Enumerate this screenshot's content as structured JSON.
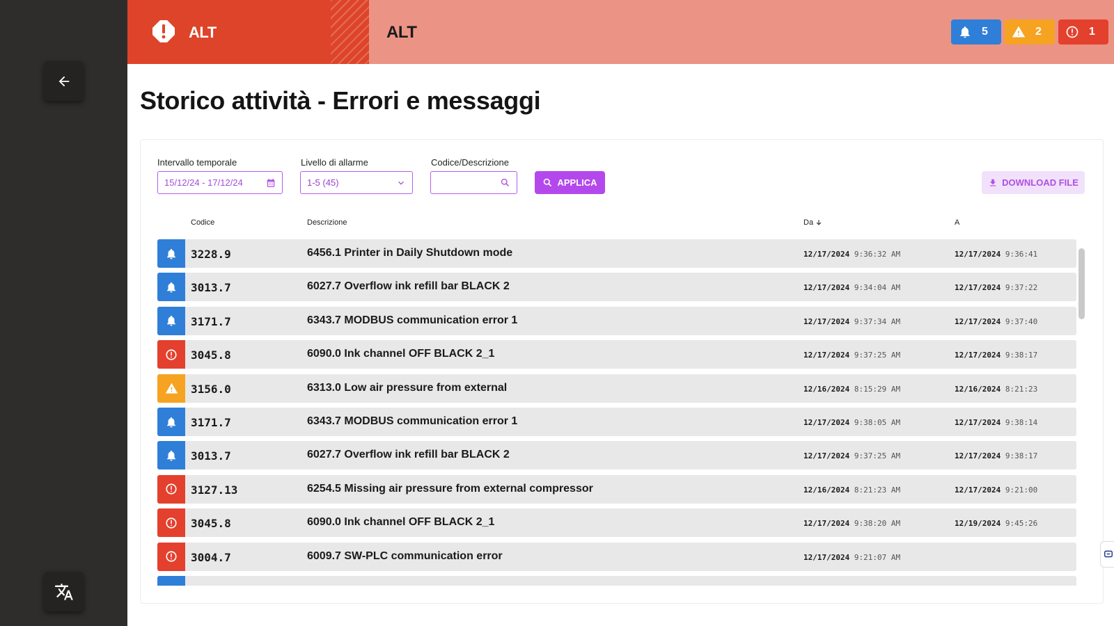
{
  "header": {
    "left_title": "ALT",
    "right_title": "ALT",
    "badges": [
      {
        "icon": "bell-icon",
        "count": "5",
        "color": "#2f7fd8"
      },
      {
        "icon": "warning-icon",
        "count": "2",
        "color": "#f6a321"
      },
      {
        "icon": "error-icon",
        "count": "1",
        "color": "#e4402e"
      }
    ]
  },
  "page": {
    "title": "Storico attività - Errori e messaggi"
  },
  "filters": {
    "interval_label": "Intervallo temporale",
    "interval_value": "15/12/24 - 17/12/24",
    "level_label": "Livello di allarme",
    "level_value": "1-5 (45)",
    "code_label": "Codice/Descrizione",
    "code_value": "",
    "apply_label": "APPLICA",
    "download_label": "DOWNLOAD FILE"
  },
  "table": {
    "headers": {
      "code": "Codice",
      "description": "Descrizione",
      "from": "Da",
      "to": "A"
    },
    "rows": [
      {
        "severity": "info",
        "code": "3228.9",
        "description": "6456.1 Printer in Daily Shutdown mode",
        "from_date": "12/17/2024",
        "from_time": "9:36:32 AM",
        "to_date": "12/17/2024",
        "to_time": "9:36:41"
      },
      {
        "severity": "info",
        "code": "3013.7",
        "description": "6027.7  Overflow ink refill bar BLACK 2",
        "from_date": "12/17/2024",
        "from_time": "9:34:04 AM",
        "to_date": "12/17/2024",
        "to_time": "9:37:22"
      },
      {
        "severity": "info",
        "code": "3171.7",
        "description": "6343.7  MODBUS communication error 1",
        "from_date": "12/17/2024",
        "from_time": "9:37:34 AM",
        "to_date": "12/17/2024",
        "to_time": "9:37:40"
      },
      {
        "severity": "error",
        "code": "3045.8",
        "description": "6090.0 Ink channel OFF BLACK 2_1",
        "from_date": "12/17/2024",
        "from_time": "9:37:25 AM",
        "to_date": "12/17/2024",
        "to_time": "9:38:17"
      },
      {
        "severity": "warning",
        "code": "3156.0",
        "description": "6313.0  Low air pressure from external",
        "from_date": "12/16/2024",
        "from_time": "8:15:29 AM",
        "to_date": "12/16/2024",
        "to_time": "8:21:23"
      },
      {
        "severity": "info",
        "code": "3171.7",
        "description": "6343.7  MODBUS communication error 1",
        "from_date": "12/17/2024",
        "from_time": "9:38:05 AM",
        "to_date": "12/17/2024",
        "to_time": "9:38:14"
      },
      {
        "severity": "info",
        "code": "3013.7",
        "description": "6027.7  Overflow ink refill bar BLACK 2",
        "from_date": "12/17/2024",
        "from_time": "9:37:25 AM",
        "to_date": "12/17/2024",
        "to_time": "9:38:17"
      },
      {
        "severity": "error",
        "code": "3127.13",
        "description": "6254.5 Missing air pressure from external compressor",
        "from_date": "12/16/2024",
        "from_time": "8:21:23 AM",
        "to_date": "12/17/2024",
        "to_time": "9:21:00"
      },
      {
        "severity": "error",
        "code": "3045.8",
        "description": "6090.0 Ink channel OFF BLACK 2_1",
        "from_date": "12/17/2024",
        "from_time": "9:38:20 AM",
        "to_date": "12/19/2024",
        "to_time": "9:45:26"
      },
      {
        "severity": "error",
        "code": "3004.7",
        "description": "6009.7  SW-PLC communication error",
        "from_date": "12/17/2024",
        "from_time": "9:21:07 AM",
        "to_date": "",
        "to_time": ""
      },
      {
        "severity": "info",
        "code": "",
        "description": "",
        "from_date": "",
        "from_time": "",
        "to_date": "",
        "to_time": ""
      }
    ]
  },
  "colors": {
    "info": "#2f7fd8",
    "warning": "#f6a321",
    "error": "#e4402e",
    "accent": "#b349ec"
  }
}
